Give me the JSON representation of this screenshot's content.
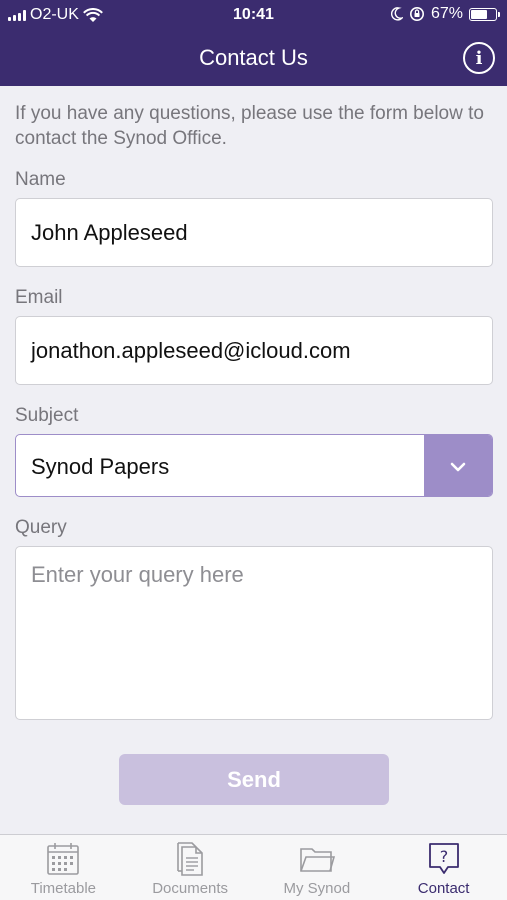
{
  "status_bar": {
    "carrier": "O2-UK",
    "time": "10:41",
    "battery": "67%",
    "battery_level": 0.67
  },
  "nav": {
    "title": "Contact Us",
    "info_icon": "info-icon"
  },
  "form": {
    "intro": "If you have any questions, please use the form below to contact the Synod Office.",
    "name_label": "Name",
    "name_value": "John Appleseed",
    "email_label": "Email",
    "email_value": "jonathon.appleseed@icloud.com",
    "subject_label": "Subject",
    "subject_value": "Synod Papers",
    "query_label": "Query",
    "query_placeholder": "Enter your query here",
    "send_label": "Send"
  },
  "tabs": [
    {
      "label": "Timetable",
      "icon": "calendar-icon"
    },
    {
      "label": "Documents",
      "icon": "document-icon"
    },
    {
      "label": "My Synod",
      "icon": "folder-icon"
    },
    {
      "label": "Contact",
      "icon": "speech-bubble-question-icon",
      "active": true
    }
  ],
  "colors": {
    "brand": "#3b2c6f",
    "accent": "#9d8dc8",
    "send_disabled": "#c9c0de"
  }
}
